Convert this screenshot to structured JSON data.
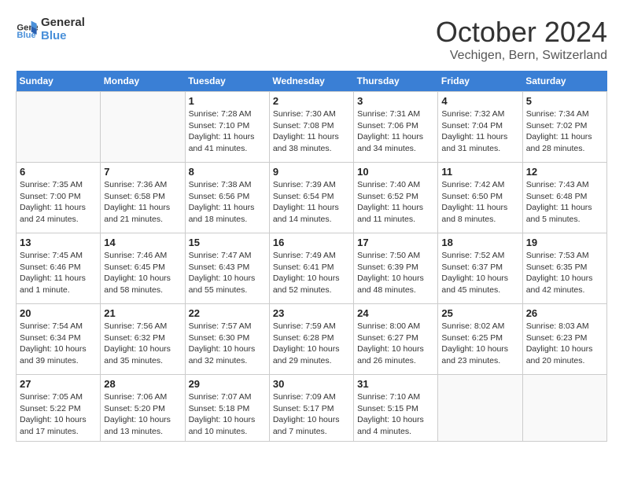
{
  "logo": {
    "line1": "General",
    "line2": "Blue"
  },
  "title": "October 2024",
  "location": "Vechigen, Bern, Switzerland",
  "weekdays": [
    "Sunday",
    "Monday",
    "Tuesday",
    "Wednesday",
    "Thursday",
    "Friday",
    "Saturday"
  ],
  "weeks": [
    [
      {
        "day": "",
        "info": ""
      },
      {
        "day": "",
        "info": ""
      },
      {
        "day": "1",
        "info": "Sunrise: 7:28 AM\nSunset: 7:10 PM\nDaylight: 11 hours and 41 minutes."
      },
      {
        "day": "2",
        "info": "Sunrise: 7:30 AM\nSunset: 7:08 PM\nDaylight: 11 hours and 38 minutes."
      },
      {
        "day": "3",
        "info": "Sunrise: 7:31 AM\nSunset: 7:06 PM\nDaylight: 11 hours and 34 minutes."
      },
      {
        "day": "4",
        "info": "Sunrise: 7:32 AM\nSunset: 7:04 PM\nDaylight: 11 hours and 31 minutes."
      },
      {
        "day": "5",
        "info": "Sunrise: 7:34 AM\nSunset: 7:02 PM\nDaylight: 11 hours and 28 minutes."
      }
    ],
    [
      {
        "day": "6",
        "info": "Sunrise: 7:35 AM\nSunset: 7:00 PM\nDaylight: 11 hours and 24 minutes."
      },
      {
        "day": "7",
        "info": "Sunrise: 7:36 AM\nSunset: 6:58 PM\nDaylight: 11 hours and 21 minutes."
      },
      {
        "day": "8",
        "info": "Sunrise: 7:38 AM\nSunset: 6:56 PM\nDaylight: 11 hours and 18 minutes."
      },
      {
        "day": "9",
        "info": "Sunrise: 7:39 AM\nSunset: 6:54 PM\nDaylight: 11 hours and 14 minutes."
      },
      {
        "day": "10",
        "info": "Sunrise: 7:40 AM\nSunset: 6:52 PM\nDaylight: 11 hours and 11 minutes."
      },
      {
        "day": "11",
        "info": "Sunrise: 7:42 AM\nSunset: 6:50 PM\nDaylight: 11 hours and 8 minutes."
      },
      {
        "day": "12",
        "info": "Sunrise: 7:43 AM\nSunset: 6:48 PM\nDaylight: 11 hours and 5 minutes."
      }
    ],
    [
      {
        "day": "13",
        "info": "Sunrise: 7:45 AM\nSunset: 6:46 PM\nDaylight: 11 hours and 1 minute."
      },
      {
        "day": "14",
        "info": "Sunrise: 7:46 AM\nSunset: 6:45 PM\nDaylight: 10 hours and 58 minutes."
      },
      {
        "day": "15",
        "info": "Sunrise: 7:47 AM\nSunset: 6:43 PM\nDaylight: 10 hours and 55 minutes."
      },
      {
        "day": "16",
        "info": "Sunrise: 7:49 AM\nSunset: 6:41 PM\nDaylight: 10 hours and 52 minutes."
      },
      {
        "day": "17",
        "info": "Sunrise: 7:50 AM\nSunset: 6:39 PM\nDaylight: 10 hours and 48 minutes."
      },
      {
        "day": "18",
        "info": "Sunrise: 7:52 AM\nSunset: 6:37 PM\nDaylight: 10 hours and 45 minutes."
      },
      {
        "day": "19",
        "info": "Sunrise: 7:53 AM\nSunset: 6:35 PM\nDaylight: 10 hours and 42 minutes."
      }
    ],
    [
      {
        "day": "20",
        "info": "Sunrise: 7:54 AM\nSunset: 6:34 PM\nDaylight: 10 hours and 39 minutes."
      },
      {
        "day": "21",
        "info": "Sunrise: 7:56 AM\nSunset: 6:32 PM\nDaylight: 10 hours and 35 minutes."
      },
      {
        "day": "22",
        "info": "Sunrise: 7:57 AM\nSunset: 6:30 PM\nDaylight: 10 hours and 32 minutes."
      },
      {
        "day": "23",
        "info": "Sunrise: 7:59 AM\nSunset: 6:28 PM\nDaylight: 10 hours and 29 minutes."
      },
      {
        "day": "24",
        "info": "Sunrise: 8:00 AM\nSunset: 6:27 PM\nDaylight: 10 hours and 26 minutes."
      },
      {
        "day": "25",
        "info": "Sunrise: 8:02 AM\nSunset: 6:25 PM\nDaylight: 10 hours and 23 minutes."
      },
      {
        "day": "26",
        "info": "Sunrise: 8:03 AM\nSunset: 6:23 PM\nDaylight: 10 hours and 20 minutes."
      }
    ],
    [
      {
        "day": "27",
        "info": "Sunrise: 7:05 AM\nSunset: 5:22 PM\nDaylight: 10 hours and 17 minutes."
      },
      {
        "day": "28",
        "info": "Sunrise: 7:06 AM\nSunset: 5:20 PM\nDaylight: 10 hours and 13 minutes."
      },
      {
        "day": "29",
        "info": "Sunrise: 7:07 AM\nSunset: 5:18 PM\nDaylight: 10 hours and 10 minutes."
      },
      {
        "day": "30",
        "info": "Sunrise: 7:09 AM\nSunset: 5:17 PM\nDaylight: 10 hours and 7 minutes."
      },
      {
        "day": "31",
        "info": "Sunrise: 7:10 AM\nSunset: 5:15 PM\nDaylight: 10 hours and 4 minutes."
      },
      {
        "day": "",
        "info": ""
      },
      {
        "day": "",
        "info": ""
      }
    ]
  ]
}
